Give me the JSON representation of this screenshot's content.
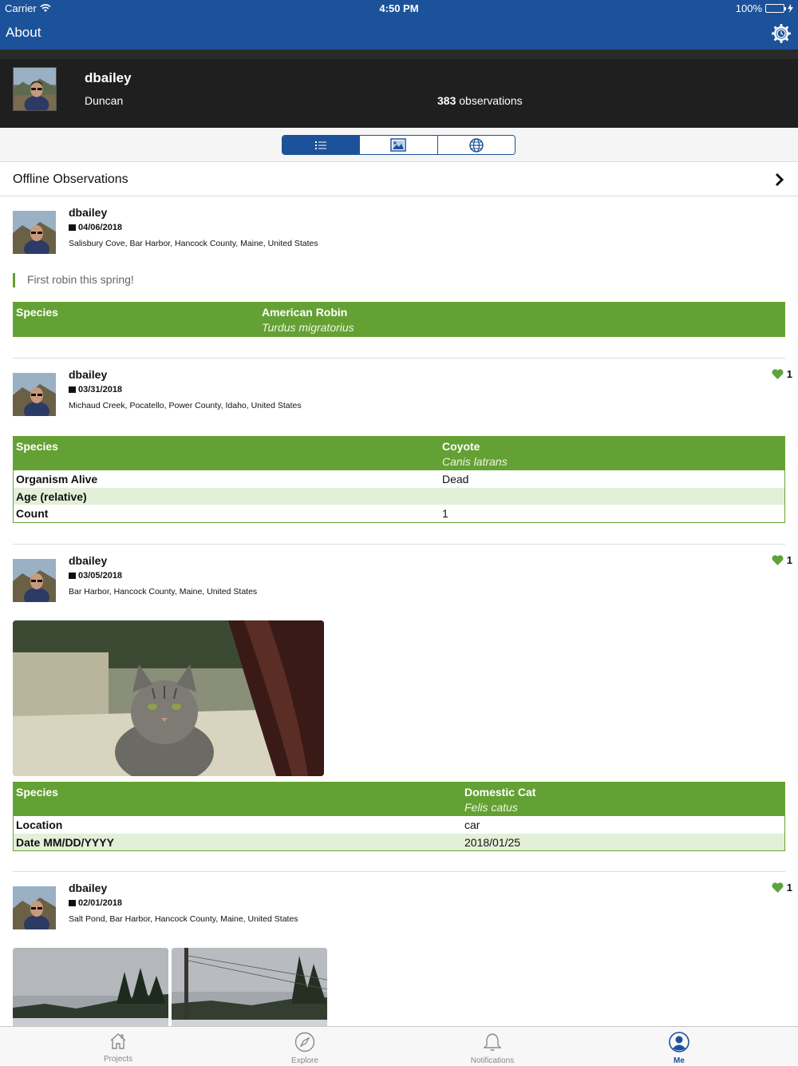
{
  "status": {
    "carrier": "Carrier",
    "time": "4:50 PM",
    "battery": "100%"
  },
  "nav": {
    "title": "About",
    "settings_icon": "gear-icon"
  },
  "profile": {
    "login": "dbailey",
    "name": "Duncan",
    "obs_count": "383",
    "obs_label": " observations"
  },
  "segments": [
    {
      "icon": "list-icon",
      "active": true
    },
    {
      "icon": "photo-grid-icon",
      "active": false
    },
    {
      "icon": "globe-icon",
      "active": false
    }
  ],
  "offline": {
    "label": "Offline Observations"
  },
  "observations": [
    {
      "user": "dbailey",
      "date": "04/06/2018",
      "place": "Salisbury Cove, Bar Harbor, Hancock County, Maine, United States",
      "note": "First robin this spring!",
      "faves": "",
      "species_key": "Species",
      "common": "American Robin",
      "scientific": "Turdus migratorius",
      "fields": []
    },
    {
      "user": "dbailey",
      "date": "03/31/2018",
      "place": "Michaud Creek, Pocatello, Power County, Idaho, United States",
      "note": "",
      "faves": "1",
      "species_key": "Species",
      "common": "Coyote",
      "scientific": "Canis latrans",
      "fields": [
        {
          "k": "Organism Alive",
          "v": "Dead"
        },
        {
          "k": "Age (relative)",
          "v": ""
        },
        {
          "k": "Count",
          "v": "1"
        }
      ]
    },
    {
      "user": "dbailey",
      "date": "03/05/2018",
      "place": "Bar Harbor, Hancock County, Maine, United States",
      "note": "",
      "faves": "1",
      "species_key": "Species",
      "common": "Domestic Cat",
      "scientific": "Felis catus",
      "fields": [
        {
          "k": "Location",
          "v": "car"
        },
        {
          "k": "Date MM/DD/YYYY",
          "v": "2018/01/25"
        }
      ]
    },
    {
      "user": "dbailey",
      "date": "02/01/2018",
      "place": "Salt Pond, Bar Harbor, Hancock County, Maine, United States",
      "note": "",
      "faves": "1"
    }
  ],
  "tabs": [
    {
      "label": "Projects",
      "icon": "house-icon"
    },
    {
      "label": "Explore",
      "icon": "compass-icon"
    },
    {
      "label": "Notifications",
      "icon": "bell-icon"
    },
    {
      "label": "Me",
      "icon": "person-icon",
      "active": true
    }
  ],
  "colors": {
    "brand_blue": "#1c5299",
    "species_green": "#64a134",
    "row_alt": "#e2f0d7",
    "fave_green": "#5ea33a"
  }
}
